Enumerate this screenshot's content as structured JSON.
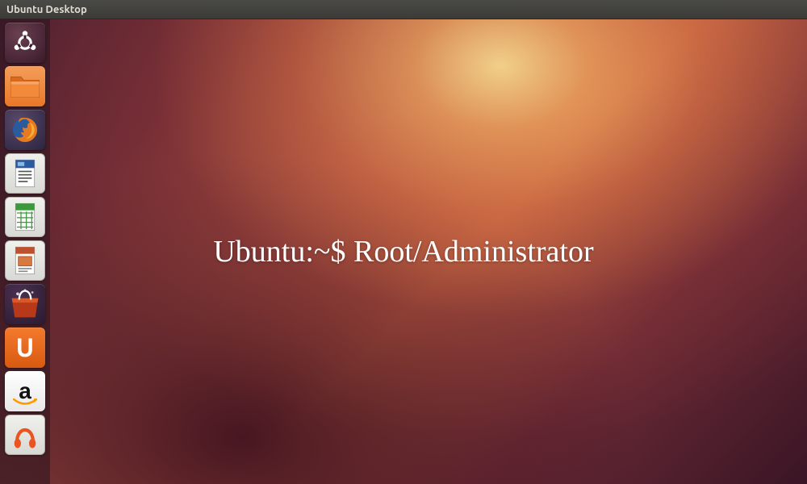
{
  "topbar": {
    "title": "Ubuntu Desktop"
  },
  "launcher": {
    "items": [
      {
        "name": "dash",
        "label": "Dash Home"
      },
      {
        "name": "files",
        "label": "Files"
      },
      {
        "name": "firefox",
        "label": "Firefox Web Browser"
      },
      {
        "name": "writer",
        "label": "LibreOffice Writer"
      },
      {
        "name": "calc",
        "label": "LibreOffice Calc"
      },
      {
        "name": "impress",
        "label": "LibreOffice Impress"
      },
      {
        "name": "software-center",
        "label": "Ubuntu Software Center"
      },
      {
        "name": "ubuntu-one",
        "label": "Ubuntu One",
        "letter": "U"
      },
      {
        "name": "amazon",
        "label": "Amazon",
        "letter": "a"
      },
      {
        "name": "music",
        "label": "Ubuntu One Music"
      }
    ]
  },
  "overlay": {
    "text": "Ubuntu:~$ Root/Administrator"
  },
  "colors": {
    "accent": "#e95420",
    "panel": "#3c3b37"
  }
}
